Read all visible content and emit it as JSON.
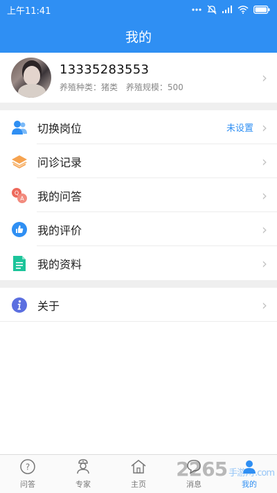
{
  "status_bar": {
    "time": "上午11:41"
  },
  "header": {
    "title": "我的"
  },
  "profile": {
    "phone": "13335283553",
    "breed_type_label": "养殖种类：猪类",
    "scale_label": "养殖规模：500"
  },
  "menu": {
    "items": [
      {
        "label": "切换岗位",
        "extra": "未设置"
      },
      {
        "label": "问诊记录"
      },
      {
        "label": "我的问答"
      },
      {
        "label": "我的评价"
      },
      {
        "label": "我的资料"
      }
    ],
    "about": {
      "label": "关于"
    }
  },
  "tabbar": {
    "tabs": [
      {
        "label": "问答"
      },
      {
        "label": "专家"
      },
      {
        "label": "主页"
      },
      {
        "label": "消息"
      },
      {
        "label": "我的"
      }
    ]
  },
  "watermark": {
    "brand": "2265",
    "suffix": "手游网",
    "domain": ".com"
  },
  "colors": {
    "primary": "#2f8ff3",
    "page_gap": "#efefef"
  }
}
